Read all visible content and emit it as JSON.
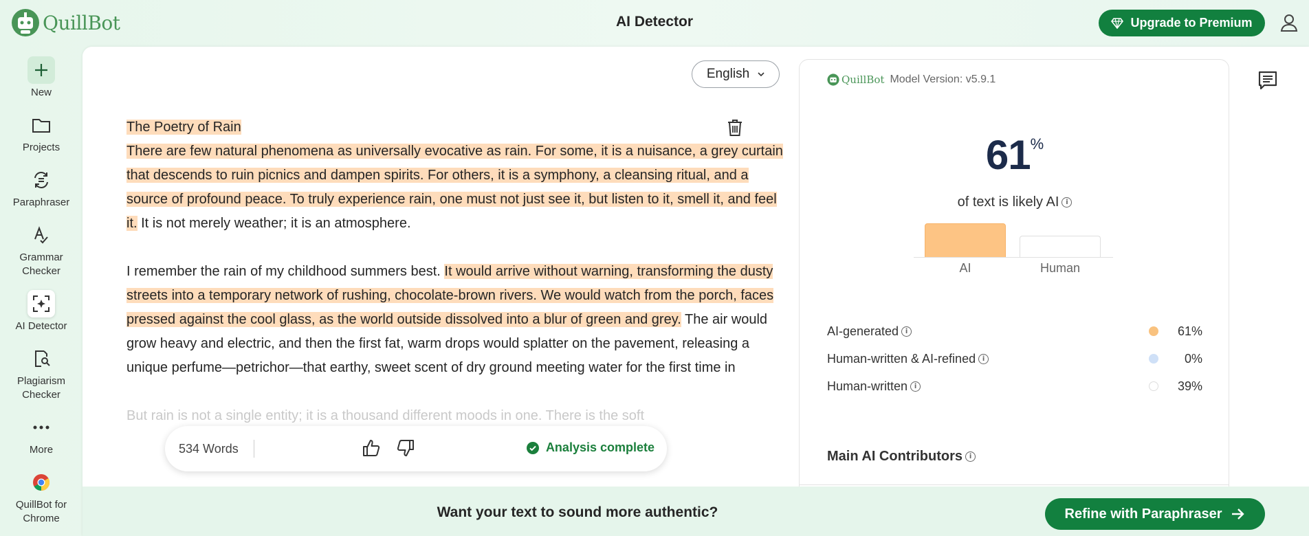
{
  "app": {
    "logo_text": "QuillBot",
    "page_title": "AI Detector"
  },
  "header": {
    "upgrade_label": "Upgrade to Premium"
  },
  "sidebar": {
    "items": [
      {
        "label": "New",
        "icon": "plus-icon"
      },
      {
        "label": "Projects",
        "icon": "folder-icon"
      },
      {
        "label": "Paraphraser",
        "icon": "paraphraser-icon"
      },
      {
        "label": "Grammar Checker",
        "icon": "grammar-icon"
      },
      {
        "label": "AI Detector",
        "icon": "ai-detector-icon"
      },
      {
        "label": "Plagiarism Checker",
        "icon": "plagiarism-icon"
      },
      {
        "label": "More",
        "icon": "more-icon"
      },
      {
        "label": "QuillBot for Chrome",
        "icon": "chrome-icon"
      }
    ]
  },
  "editor": {
    "language": "English",
    "title": "The Poetry of Rain",
    "p1_hl": "There are few natural phenomena as universally evocative as rain. For some, it is a nuisance, a grey curtain that descends to ruin picnics and dampen spirits. For others, it is a symphony, a cleansing ritual, and a source of profound peace. To truly experience rain, one must not just see it, but listen to it, smell it, and feel it.",
    "p1_plain": " It is not merely weather; it is an atmosphere.",
    "p2_plain_a": "I remember the rain of my childhood summers best. ",
    "p2_hl": "It would arrive without warning, transforming the dusty streets into a temporary network of rushing, chocolate-brown rivers. We would watch from the porch, faces pressed against the cool glass, as the world outside dissolved into a blur of green and grey.",
    "p2_plain_b": " The air would grow heavy and electric, and then the first fat, warm drops would splatter on the pavement, releasing a unique perfume—petrichor—that earthy, sweet scent of dry ground meeting water for the first time in",
    "p3_faded": "But rain is not a single entity; it is a thousand different moods in one. There is the soft"
  },
  "status": {
    "word_count": "534 Words",
    "analysis": "Analysis complete"
  },
  "panel": {
    "mini_logo": "QuillBot",
    "model_version": "Model Version: v5.9.1",
    "ai_percent": "61",
    "percent_symbol": "%",
    "likely_text": "of text is likely AI",
    "bar_ai_label": "AI",
    "bar_human_label": "Human",
    "bar_ai_fraction": 0.61,
    "bar_human_fraction": 0.39,
    "legend": [
      {
        "label": "AI-generated",
        "value": "61%",
        "color": "#f9c27f"
      },
      {
        "label": "Human-written & AI-refined",
        "value": "0%",
        "color": "#cfe0f7"
      },
      {
        "label": "Human-written",
        "value": "39%",
        "color": "#ffffff"
      }
    ],
    "contributors_title": "Main AI Contributors"
  },
  "bottom": {
    "prompt": "Want your text to sound more authentic?",
    "refine_label": "Refine with Paraphraser"
  },
  "colors": {
    "brand_green": "#12803f",
    "highlight": "#fedcbb",
    "ai_bar": "#fdc484"
  }
}
